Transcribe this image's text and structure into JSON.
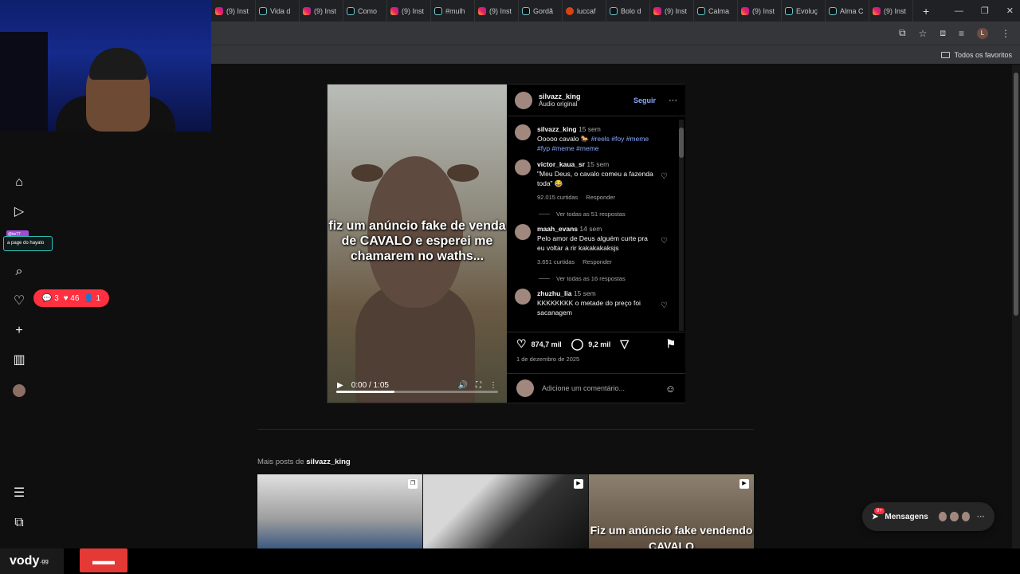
{
  "browser": {
    "tabs": [
      {
        "icon": "instagram-icon",
        "label": "(9) Inst"
      },
      {
        "icon": "tiktok-icon",
        "label": "Vida d"
      },
      {
        "icon": "instagram-icon",
        "label": "(9) Inst"
      },
      {
        "icon": "tiktok-icon",
        "label": "Como"
      },
      {
        "icon": "instagram-icon",
        "label": "(9) Inst"
      },
      {
        "icon": "tiktok-icon",
        "label": "#mulh"
      },
      {
        "icon": "instagram-icon",
        "label": "(9) Inst"
      },
      {
        "icon": "tiktok-icon",
        "label": "Gordã"
      },
      {
        "icon": "lucca-icon",
        "label": "luccaf"
      },
      {
        "icon": "tiktok-icon",
        "label": "Bolo d"
      },
      {
        "icon": "instagram-icon",
        "label": "(9) Inst"
      },
      {
        "icon": "tiktok-icon",
        "label": "Calma"
      },
      {
        "icon": "instagram-icon",
        "label": "(9) Inst"
      },
      {
        "icon": "tiktok-icon",
        "label": "Evoluç"
      },
      {
        "icon": "tiktok-icon",
        "label": "Alma C"
      },
      {
        "icon": "instagram-icon",
        "label": "(9) Inst"
      }
    ],
    "new_tab": "+",
    "profile_initial": "L",
    "bookmarks_label": "Todos os favoritos"
  },
  "nav": {
    "stream_tag_top": "@tw77",
    "stream_tag": "a page do hayato",
    "notifications": {
      "comments": "3",
      "likes": "46",
      "follows": "1"
    }
  },
  "post": {
    "author": "silvazz_king",
    "audio": "Áudio original",
    "follow_label": "Seguir",
    "video": {
      "overlay_text": "fiz um anúncio fake de venda de CAVALO e esperei me chamarem no waths...",
      "time": "0:00 / 1:05",
      "progress": 0.36
    },
    "caption": {
      "author": "silvazz_king",
      "age": "15 sem",
      "text": "Ooooo cavalo 🐎",
      "tags": "#reels #foy #meme #fyp #meme #meme"
    },
    "comments": [
      {
        "author": "victor_kaua_sr",
        "age": "15 sem",
        "text": "\"Meu Deus, o cavalo comeu a fazenda toda\" 😂",
        "likes": "92.015 curtidas",
        "reply": "Responder",
        "replies": "Ver todas as 51 respostas"
      },
      {
        "author": "maah_evans",
        "age": "14 sem",
        "text": "Pelo amor de Deus alguém curte pra eu voltar a rir kakakakaksjs",
        "likes": "3.651 curtidas",
        "reply": "Responder",
        "replies": "Ver todas as 16 respostas"
      },
      {
        "author": "zhuzhu_lia",
        "age": "15 sem",
        "text": "KKKKKKKK o metade do preço foi sacanagem",
        "likes": "",
        "reply": "",
        "replies": ""
      }
    ],
    "likes": "874,7 mil",
    "comment_count": "9,2 mil",
    "date": "1 de dezembro de 2025",
    "add_comment_placeholder": "Adicione um comentário..."
  },
  "more_posts": {
    "prefix": "Mais posts de",
    "author": "silvazz_king",
    "thumb3_text": "Fiz um anúncio fake vendendo CAVALO"
  },
  "messages": {
    "label": "Mensagens",
    "badge": "9+"
  },
  "watermark": {
    "brand": "vody",
    "suffix": ".gg"
  }
}
